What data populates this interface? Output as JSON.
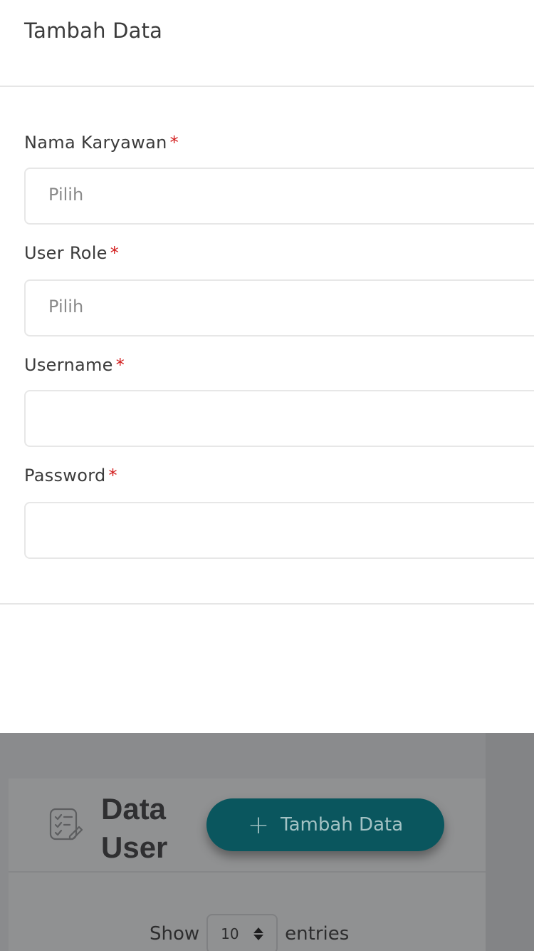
{
  "modal": {
    "title": "Tambah Data",
    "fields": [
      {
        "label": "Nama Karyawan",
        "required_mark": "*",
        "type": "select",
        "placeholder": "Pilih"
      },
      {
        "label": "User Role",
        "required_mark": "*",
        "type": "select",
        "placeholder": "Pilih"
      },
      {
        "label": "Username",
        "required_mark": "*",
        "type": "text",
        "value": ""
      },
      {
        "label": "Password",
        "required_mark": "*",
        "type": "password",
        "value": ""
      }
    ]
  },
  "background": {
    "card_title": "Data User",
    "add_button_label": "Tambah Data",
    "add_button_icon": "plus-icon",
    "card_icon": "checklist-edit-icon",
    "show_label": "Show",
    "entries_value": "10",
    "entries_label": "entries",
    "accent_color": "#0a565e"
  }
}
